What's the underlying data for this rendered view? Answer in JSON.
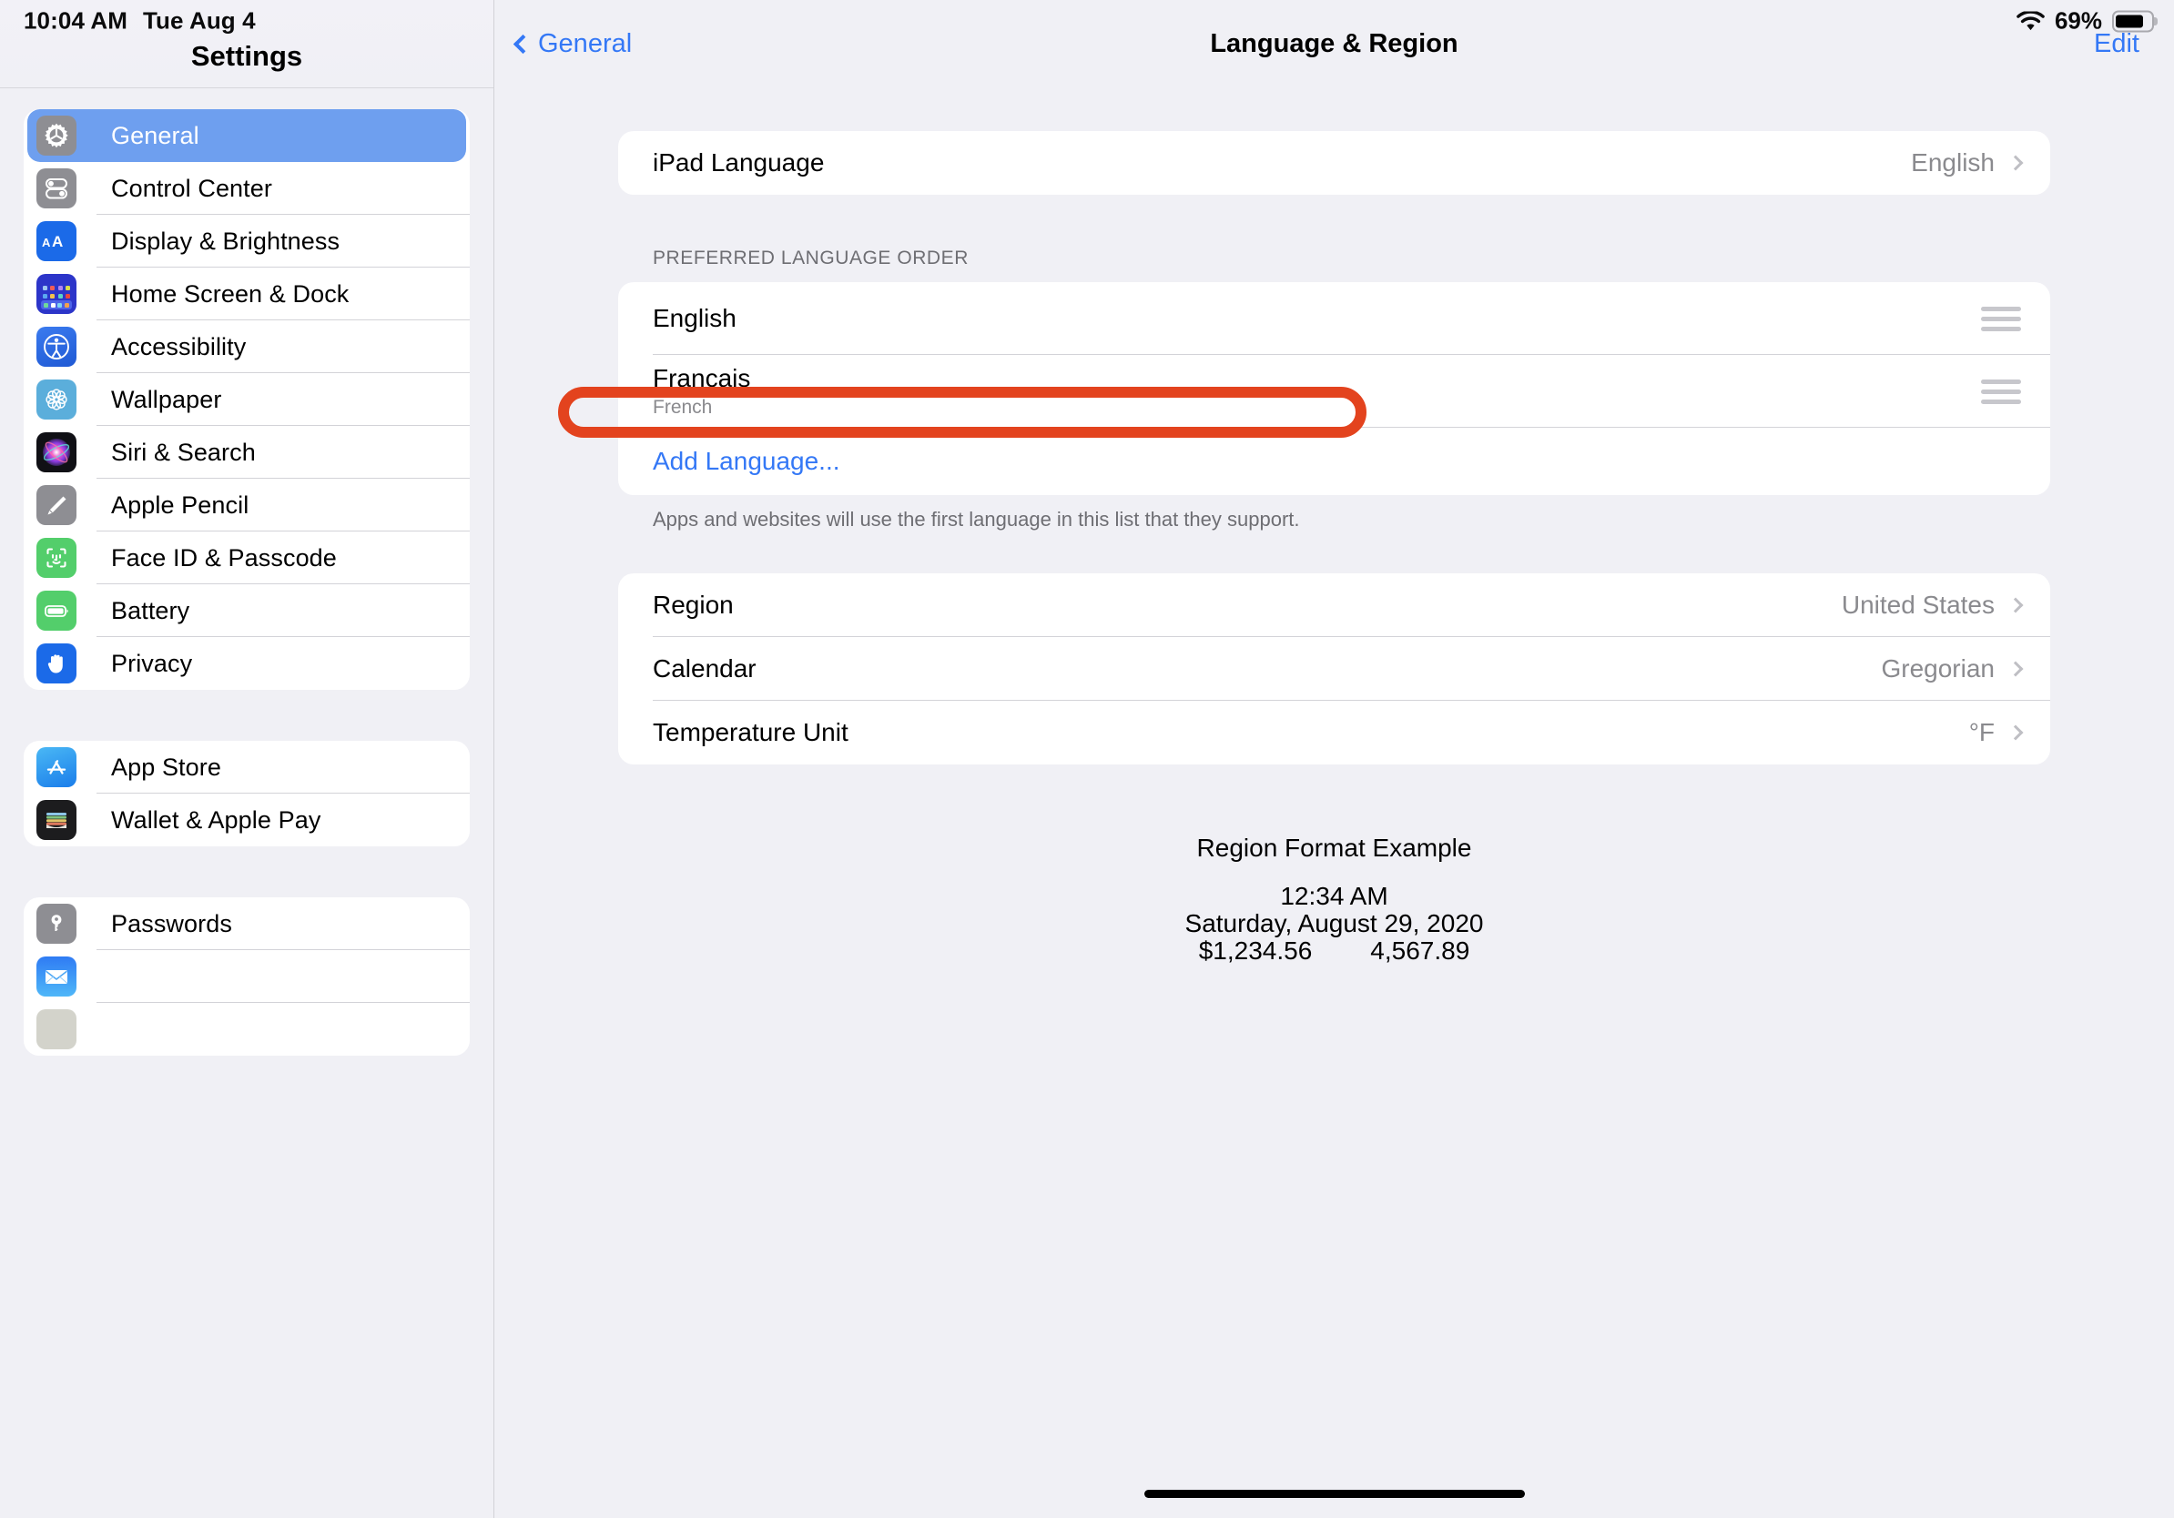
{
  "status_bar": {
    "time": "10:04 AM",
    "date": "Tue Aug 4",
    "wifi_icon": "wifi-icon",
    "battery_percent": "69%",
    "battery_icon": "battery-icon"
  },
  "sidebar": {
    "title": "Settings",
    "groups": [
      {
        "items": [
          {
            "label": "General",
            "icon": "gear-icon",
            "selected": true
          },
          {
            "label": "Control Center",
            "icon": "control-center-icon",
            "selected": false
          },
          {
            "label": "Display & Brightness",
            "icon": "display-brightness-icon",
            "selected": false
          },
          {
            "label": "Home Screen & Dock",
            "icon": "home-screen-dock-icon",
            "selected": false
          },
          {
            "label": "Accessibility",
            "icon": "accessibility-icon",
            "selected": false
          },
          {
            "label": "Wallpaper",
            "icon": "wallpaper-icon",
            "selected": false
          },
          {
            "label": "Siri & Search",
            "icon": "siri-search-icon",
            "selected": false
          },
          {
            "label": "Apple Pencil",
            "icon": "apple-pencil-icon",
            "selected": false
          },
          {
            "label": "Face ID & Passcode",
            "icon": "face-id-icon",
            "selected": false
          },
          {
            "label": "Battery",
            "icon": "battery-icon",
            "selected": false
          },
          {
            "label": "Privacy",
            "icon": "privacy-hand-icon",
            "selected": false
          }
        ]
      },
      {
        "items": [
          {
            "label": "App Store",
            "icon": "app-store-icon",
            "selected": false
          },
          {
            "label": "Wallet & Apple Pay",
            "icon": "wallet-icon",
            "selected": false
          }
        ]
      },
      {
        "items": [
          {
            "label": "Passwords",
            "icon": "passwords-key-icon",
            "selected": false
          },
          {
            "label": "Mail",
            "icon": "mail-envelope-icon",
            "selected": false
          }
        ]
      }
    ]
  },
  "detail": {
    "nav": {
      "back_label": "General",
      "back_icon": "chevron-left-icon",
      "title": "Language & Region",
      "edit_label": "Edit"
    },
    "device_language": {
      "label": "iPad Language",
      "value": "English",
      "chevron": "chevron-right-icon"
    },
    "preferred_order": {
      "header": "PREFERRED LANGUAGE ORDER",
      "languages": [
        {
          "name": "English",
          "translation": "",
          "handle": "drag-handle-icon"
        },
        {
          "name": "Français",
          "translation": "French",
          "handle": "drag-handle-icon"
        }
      ],
      "add_label": "Add Language...",
      "footnote": "Apps and websites will use the first language in this list that they support."
    },
    "region_settings": [
      {
        "label": "Region",
        "value": "United States",
        "chevron": "chevron-right-icon"
      },
      {
        "label": "Calendar",
        "value": "Gregorian",
        "chevron": "chevron-right-icon"
      },
      {
        "label": "Temperature Unit",
        "value": "°F",
        "chevron": "chevron-right-icon"
      }
    ],
    "region_format_example": {
      "title": "Region Format Example",
      "time": "12:34 AM",
      "date": "Saturday, August 29, 2020",
      "currency": "$1,234.56",
      "number": "4,567.89"
    }
  },
  "annotation": {
    "target": "Add Language...",
    "color": "#E3431E"
  },
  "colors": {
    "accent_blue": "#3478F6",
    "selection_blue": "#6E9FEF",
    "background": "#F0F0F5",
    "card": "#FFFFFF",
    "secondary_text": "#8A8A8E",
    "highlight_red": "#E3431E"
  }
}
